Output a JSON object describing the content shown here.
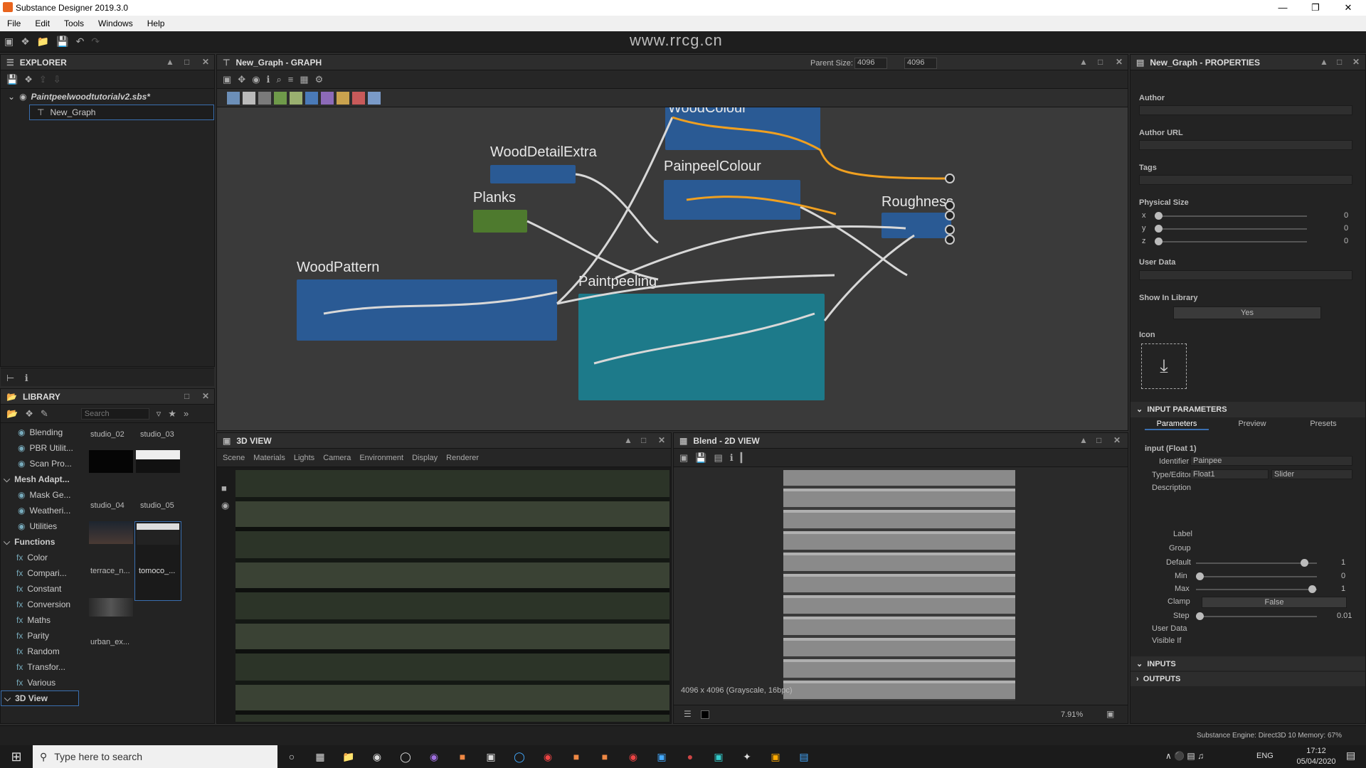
{
  "app": {
    "title": "Substance Designer 2019.3.0",
    "menu": [
      "File",
      "Edit",
      "Tools",
      "Windows",
      "Help"
    ]
  },
  "explorer": {
    "title": "EXPLORER",
    "file": "Paintpeelwoodtutorialv2.sbs*",
    "graph": "New_Graph"
  },
  "graph": {
    "title": "New_Graph - GRAPH",
    "parent_size_label": "Parent Size:",
    "size_a": "4096",
    "size_b": "4096",
    "frames": {
      "woodcolour": "WoodColour",
      "detail": "WoodDetailExtra",
      "planks": "Planks",
      "paintcolour": "PainpeelColour",
      "roughness": "Roughness",
      "pattern": "WoodPattern",
      "peeling": "Paintpeeling"
    }
  },
  "properties": {
    "title": "New_Graph - PROPERTIES",
    "author": "Author",
    "author_url": "Author URL",
    "tags": "Tags",
    "physical_size": "Physical Size",
    "axes": [
      "x",
      "y",
      "z"
    ],
    "axis_values": [
      "0",
      "0",
      "0"
    ],
    "user_data": "User Data",
    "show_in_library": "Show In Library",
    "show_value": "Yes",
    "icon": "Icon",
    "input_params": "INPUT PARAMETERS",
    "tabs": [
      "Parameters",
      "Preview",
      "Presets"
    ],
    "input_name": "input (Float 1)",
    "identifier_label": "Identifier",
    "identifier_value": "Painpee",
    "type_label": "Type/Editor",
    "type_value": "Float1",
    "editor_value": "Slider",
    "description_label": "Description",
    "label_label": "Label",
    "group_label": "Group",
    "default_label": "Default",
    "default_value": "1",
    "default_level": 0.9,
    "min_label": "Min",
    "min_value": "0",
    "max_label": "Max",
    "max_value": "1",
    "clamp_label": "Clamp",
    "clamp_value": "False",
    "step_label": "Step",
    "step_value": "0.01",
    "userdata_label": "User Data",
    "visible_label": "Visible If",
    "inputs": "INPUTS",
    "outputs": "OUTPUTS"
  },
  "library": {
    "title": "LIBRARY",
    "search_placeholder": "Search",
    "tree": [
      {
        "label": "Blending",
        "kind": "item"
      },
      {
        "label": "PBR Utilit...",
        "kind": "item"
      },
      {
        "label": "Scan Pro...",
        "kind": "item"
      },
      {
        "label": "Mesh Adapt...",
        "kind": "group"
      },
      {
        "label": "Mask Ge...",
        "kind": "item"
      },
      {
        "label": "Weatheri...",
        "kind": "item"
      },
      {
        "label": "Utilities",
        "kind": "item"
      },
      {
        "label": "Functions",
        "kind": "group"
      },
      {
        "label": "Color",
        "kind": "fn"
      },
      {
        "label": "Compari...",
        "kind": "fn"
      },
      {
        "label": "Constant",
        "kind": "fn"
      },
      {
        "label": "Conversion",
        "kind": "fn"
      },
      {
        "label": "Maths",
        "kind": "fn"
      },
      {
        "label": "Parity",
        "kind": "fn"
      },
      {
        "label": "Random",
        "kind": "fn"
      },
      {
        "label": "Transfor...",
        "kind": "fn"
      },
      {
        "label": "Various",
        "kind": "fn"
      },
      {
        "label": "3D View",
        "kind": "group"
      }
    ],
    "thumbs": [
      "studio_02",
      "studio_03",
      "studio_04",
      "studio_05",
      "terrace_n...",
      "tomoco_...",
      "urban_ex..."
    ]
  },
  "view3d": {
    "title": "3D VIEW",
    "menu": [
      "Scene",
      "Materials",
      "Lights",
      "Camera",
      "Environment",
      "Display",
      "Renderer"
    ]
  },
  "view2d": {
    "title": "Blend - 2D VIEW",
    "status": "4096 x 4096 (Grayscale, 16bpc)",
    "zoom": "7.91%"
  },
  "statusbar": {
    "engine": "Substance Engine: Direct3D 10  Memory: 67%"
  },
  "taskbar": {
    "search_placeholder": "Type here to search",
    "lang": "ENG",
    "time": "17:12",
    "date": "05/04/2020"
  },
  "watermark": {
    "url": "www.rrcg.cn"
  }
}
